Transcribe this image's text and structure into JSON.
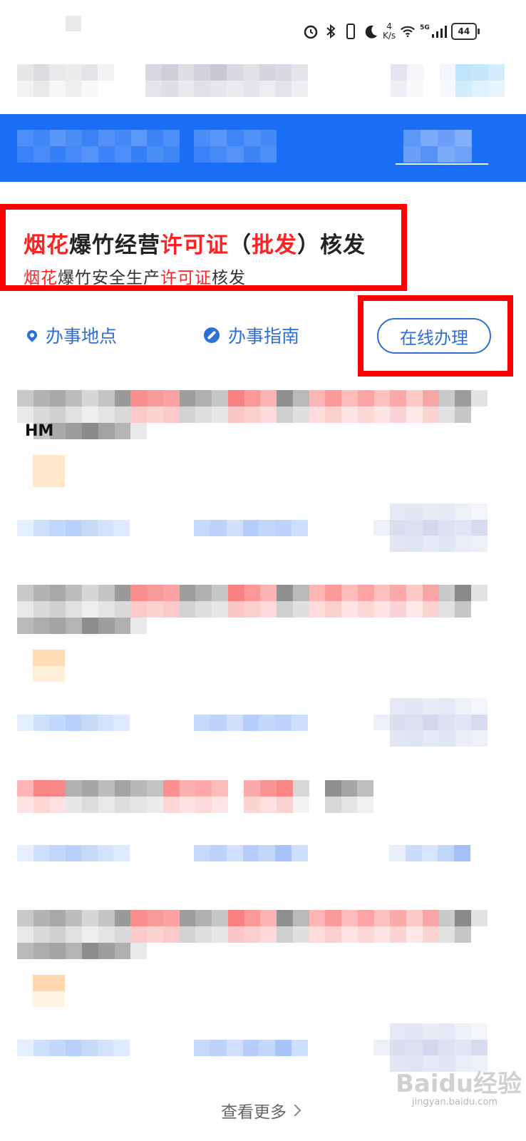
{
  "status_bar": {
    "speed_value": "4",
    "speed_unit": "K/s",
    "network": "5G",
    "battery": "44",
    "icons": [
      "alarm-icon",
      "bluetooth-icon",
      "vibrate-icon",
      "moon-icon",
      "wifi-icon",
      "signal-icon"
    ]
  },
  "item": {
    "title_parts": [
      "烟花",
      "爆竹经营",
      "许可证",
      "（",
      "批发",
      "）核发"
    ],
    "subtitle_parts": [
      "烟花",
      "爆竹安全生产",
      "许可证",
      "核发"
    ]
  },
  "actions": {
    "location_label": "办事地点",
    "guide_label": "办事指南",
    "online_label": "在线办理"
  },
  "partial_text": "HM",
  "footer": {
    "more_label": "查看更多",
    "watermark": "Baidu经验",
    "watermark_sub": "jingyan.baidu.com"
  },
  "colors": {
    "banner_blue": "#1a6df5",
    "highlight_red": "#ff0000",
    "link_blue": "#2f6fd6"
  }
}
